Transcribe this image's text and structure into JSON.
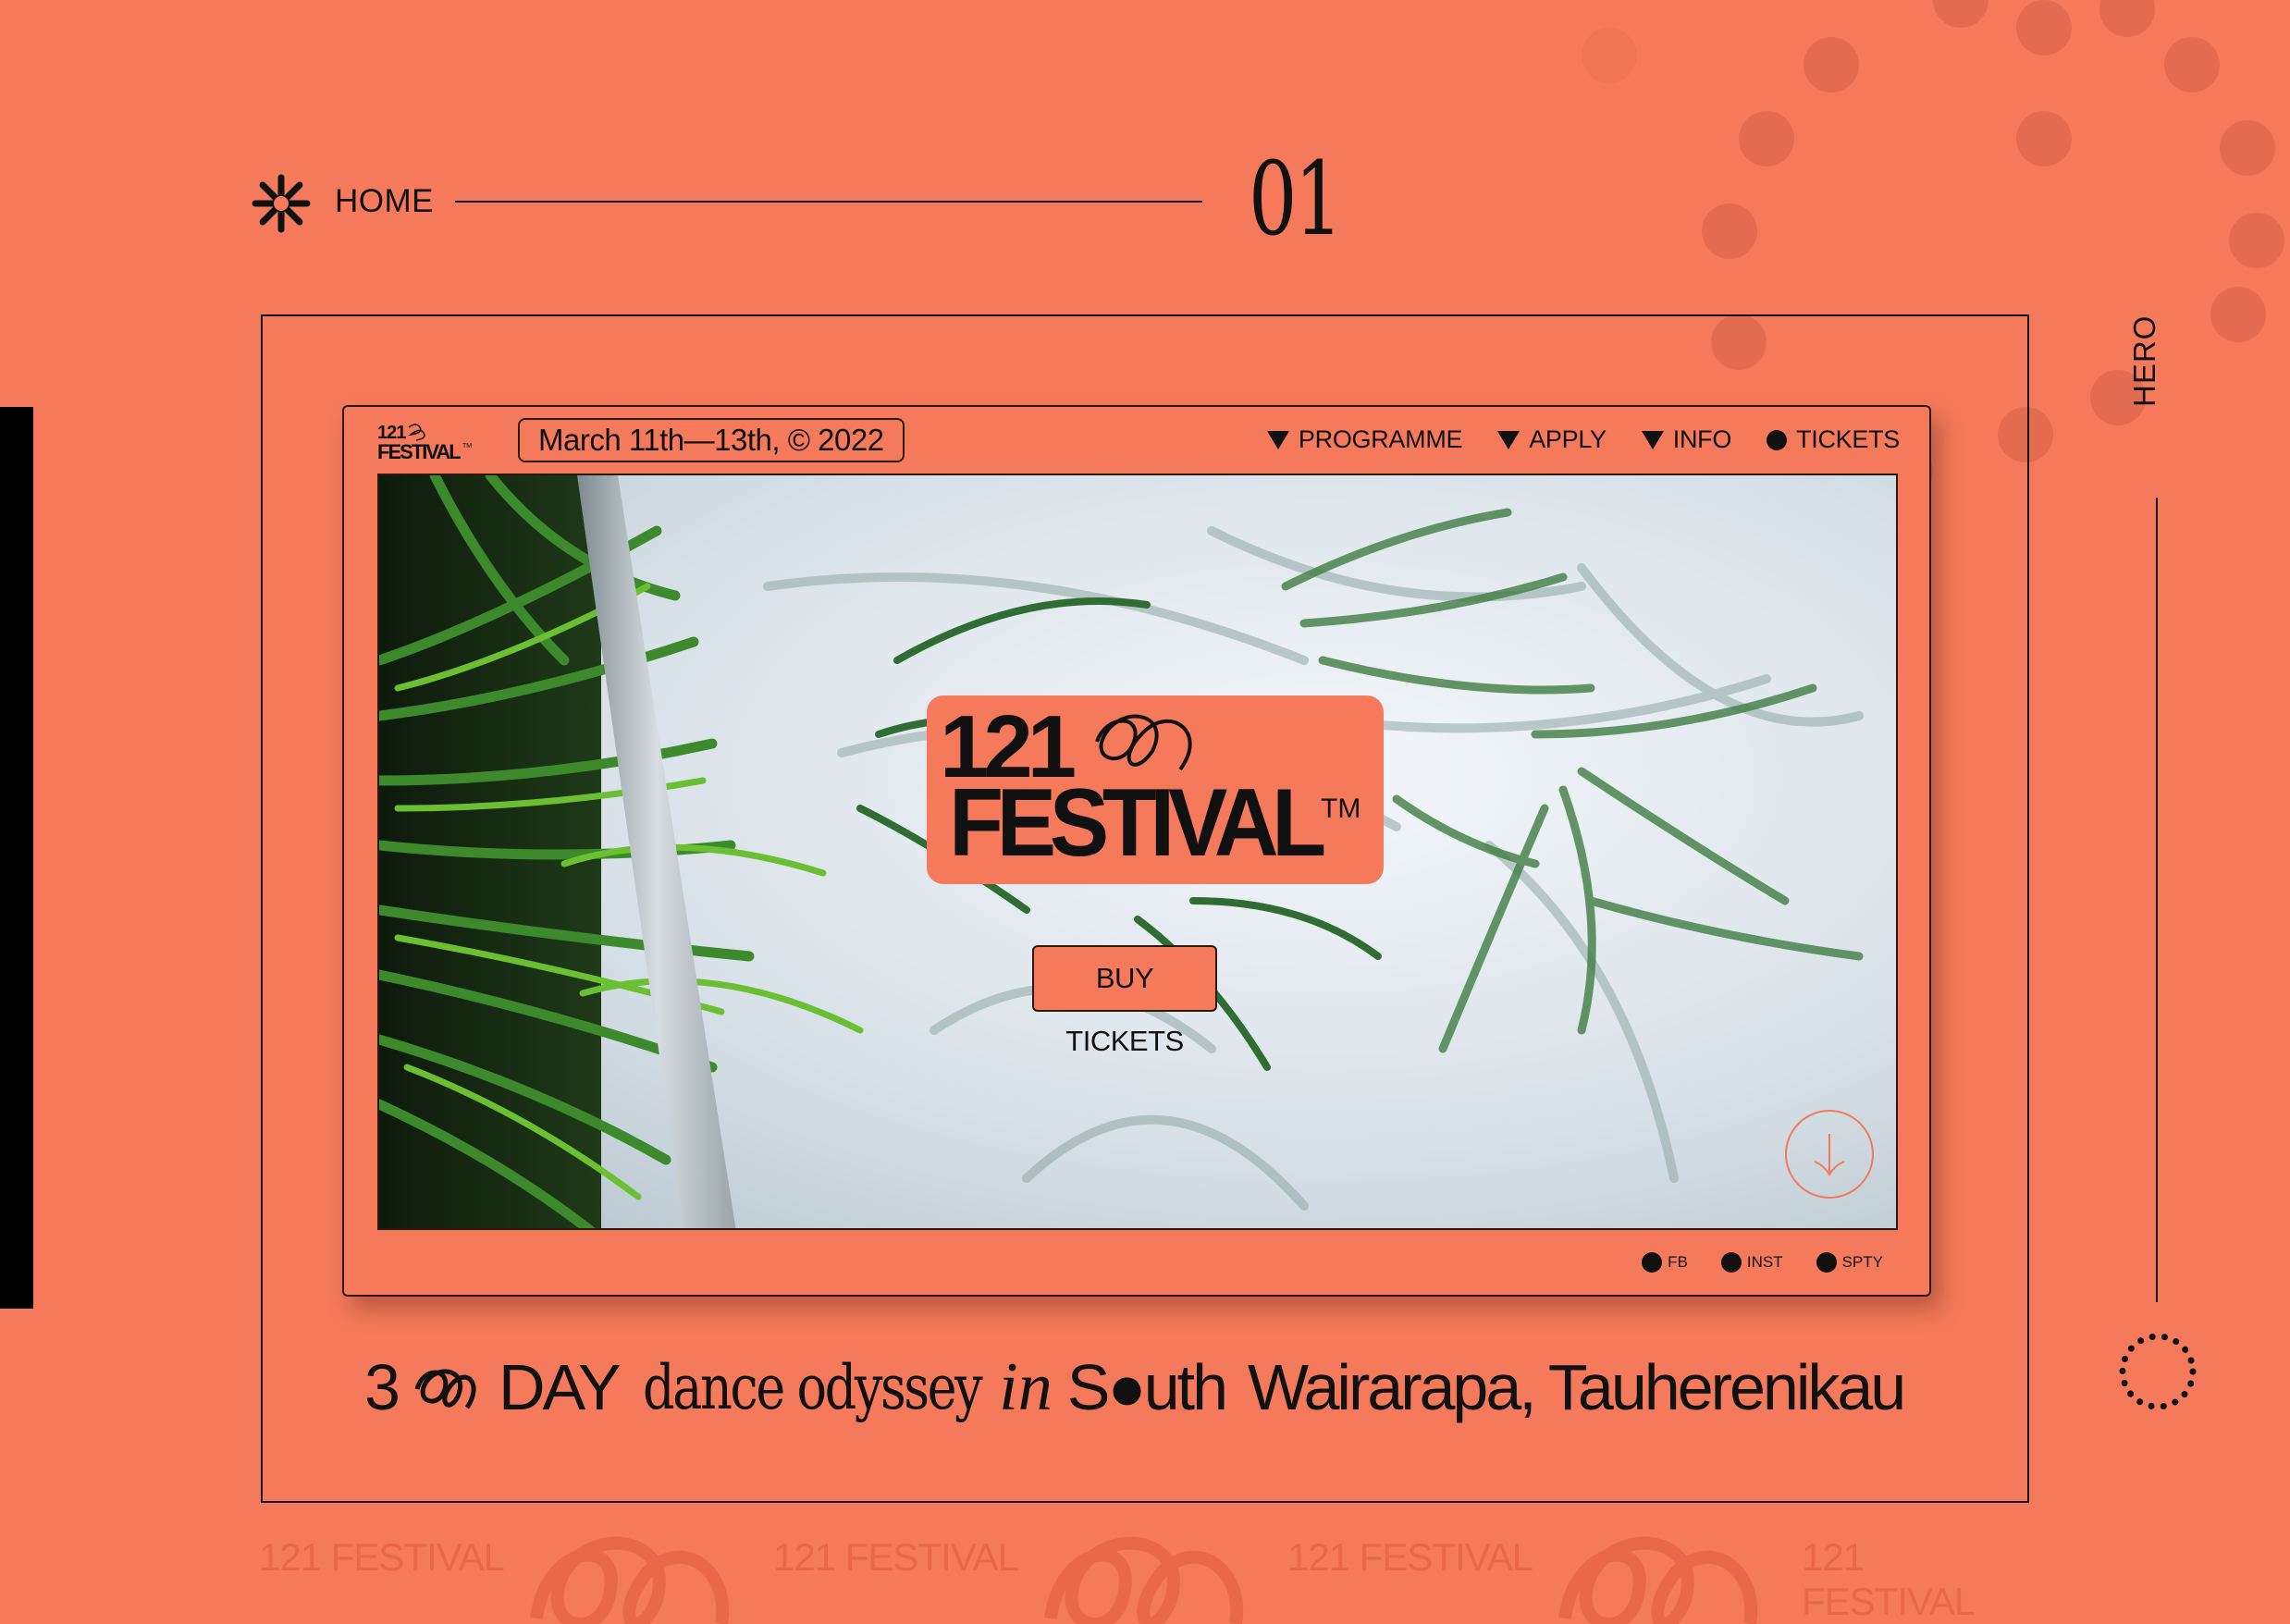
{
  "nav": {
    "home_label": "HOME",
    "page_number": "01"
  },
  "side": {
    "section_label": "HERO"
  },
  "site": {
    "mini_logo_line1": "121",
    "mini_logo_line2": "FESTIVAL",
    "mini_logo_tm": "TM",
    "date_label": "March 11th—13th, © 2022",
    "menu": [
      {
        "label": "PROGRAMME",
        "icon": "triangle-down-icon"
      },
      {
        "label": "APPLY",
        "icon": "triangle-down-icon"
      },
      {
        "label": "INFO",
        "icon": "triangle-down-icon"
      },
      {
        "label": "TICKETS",
        "icon": "dot-icon"
      }
    ],
    "hero_logo_number": "121",
    "hero_logo_word": "FESTIVAL",
    "hero_logo_tm": "TM",
    "buy_button": "BUY TICKETS",
    "socials": [
      "FB",
      "INST",
      "SPTY"
    ]
  },
  "tagline": {
    "part1": "3",
    "part2": "DAY",
    "part3": "dance odyssey",
    "part4": "in",
    "part5": "S●uth",
    "part6": "Wairarapa, Tauherenikau"
  },
  "watermark": {
    "repeat_text": "121 FESTIVAL"
  },
  "colors": {
    "background": "#F47A5B",
    "ink": "#111111",
    "watermark": "#E9684B"
  }
}
